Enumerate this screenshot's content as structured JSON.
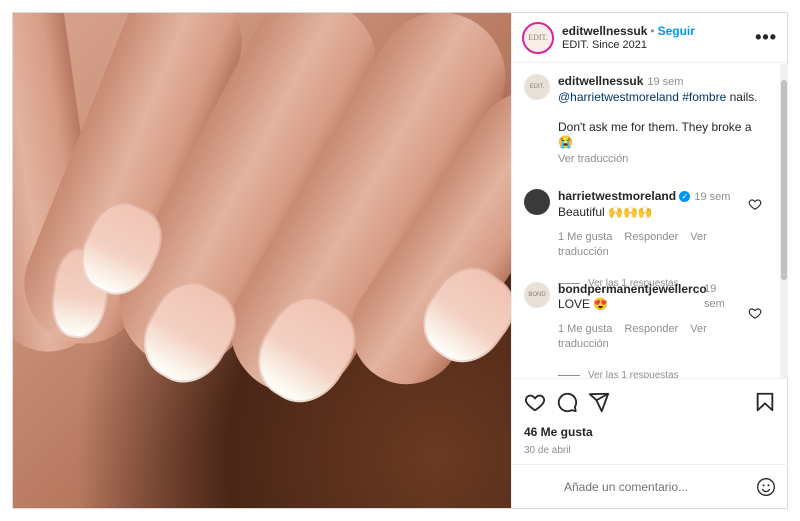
{
  "header": {
    "avatar_text": "EDIT.",
    "username": "editwellnessuk",
    "dot": "•",
    "follow_label": "Seguir",
    "subtitle": "EDIT. Since 2021",
    "more_label": "•••"
  },
  "comments": [
    {
      "avatar_text": "EDIT.",
      "username": "editwellnessuk",
      "time": "19 sem",
      "mention": "@harrietwestmoreland",
      "hashtag": "#fombre",
      "text_after": " nails.",
      "text2": "Don't ask me for them. They broke a",
      "emoji": "😭",
      "translate": "Ver traducción"
    },
    {
      "username": "harrietwestmoreland",
      "time": "19 sem",
      "text": "Beautiful",
      "emoji": "🙌🙌🙌",
      "likes": "1 Me gusta",
      "reply": "Responder",
      "translate": "Ver traducción",
      "replies": "Ver las 1 respuestas"
    },
    {
      "avatar_text": "BOND",
      "username": "bondpermanentjewellerco",
      "time": "19 sem",
      "text": "LOVE",
      "emoji": "😍",
      "likes": "1 Me gusta",
      "reply": "Responder",
      "translate": "Ver traducción",
      "replies": "Ver las 1 respuestas"
    }
  ],
  "actions": {
    "likes": "46 Me gusta",
    "date": "30 de abril"
  },
  "add_comment": {
    "placeholder": "Añade un comentario..."
  },
  "colors": {
    "follow": "#0095f6",
    "link": "#00376b",
    "muted": "#8e8e8e"
  },
  "icons": [
    "heart-icon",
    "comment-icon",
    "share-icon",
    "bookmark-icon",
    "emoji-icon",
    "more-icon",
    "verified-icon"
  ]
}
